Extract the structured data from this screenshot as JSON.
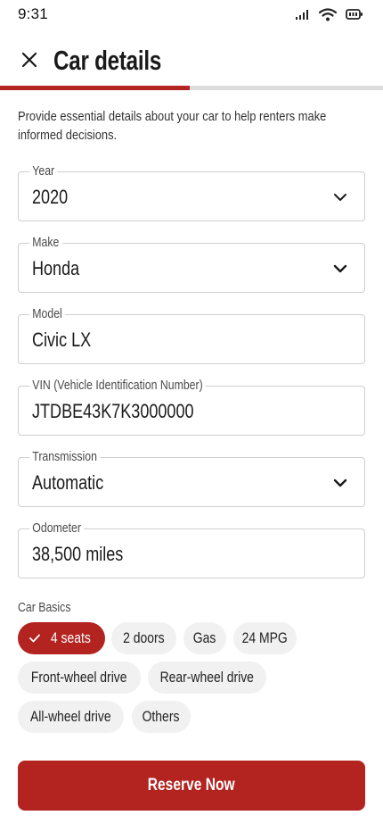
{
  "status_bar": {
    "time": "9:31"
  },
  "header": {
    "title": "Car details"
  },
  "progress": {
    "fraction": 0.495
  },
  "intro_text": "Provide essential details about your car to help renters make informed decisions.",
  "fields": {
    "year": {
      "label": "Year",
      "value": "2020"
    },
    "make": {
      "label": "Make",
      "value": "Honda"
    },
    "model": {
      "label": "Model",
      "value": "Civic LX"
    },
    "vin": {
      "label": "VIN (Vehicle Identification Number)",
      "value": "JTDBE43K7K3000000"
    },
    "transmission": {
      "label": "Transmission",
      "value": "Automatic"
    },
    "odometer": {
      "label": "Odometer",
      "value": "38,500 miles"
    }
  },
  "car_basics": {
    "label": "Car Basics",
    "chips": [
      {
        "label": "4 seats",
        "selected": true
      },
      {
        "label": "2 doors",
        "selected": false
      },
      {
        "label": "Gas",
        "selected": false
      },
      {
        "label": "24 MPG",
        "selected": false
      },
      {
        "label": "Front-wheel drive",
        "selected": false
      },
      {
        "label": "Rear-wheel drive",
        "selected": false
      },
      {
        "label": "All-wheel drive",
        "selected": false
      },
      {
        "label": "Others",
        "selected": false
      }
    ]
  },
  "cta": {
    "label": "Reserve Now"
  },
  "colors": {
    "accent": "#b3231f",
    "chip_bg": "#f1f1f1",
    "track": "#dddddd"
  }
}
